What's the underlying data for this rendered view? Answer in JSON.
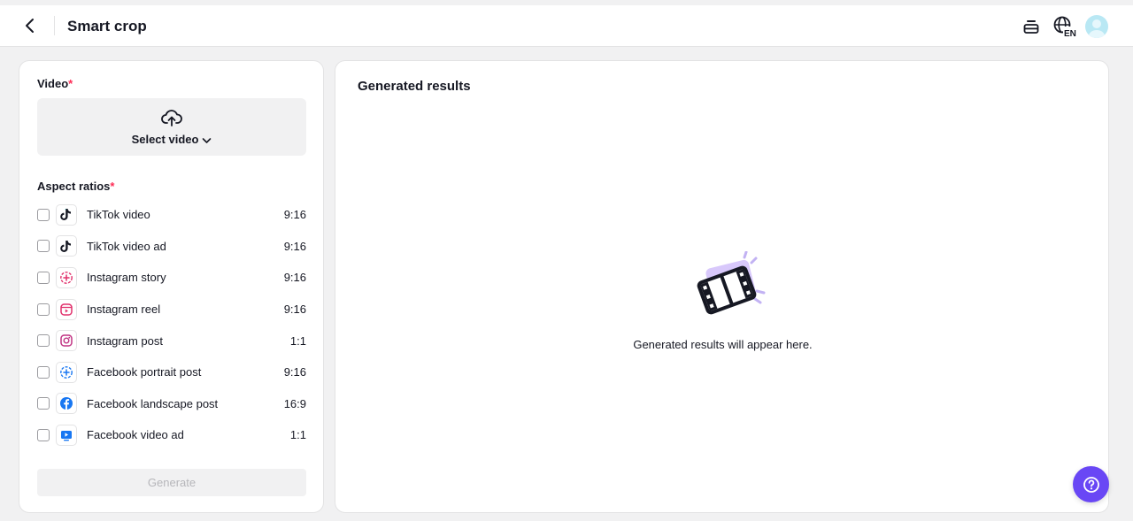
{
  "header": {
    "title": "Smart crop",
    "icons": [
      "back-arrow-icon",
      "queue-icon",
      "globe-language-icon",
      "avatar"
    ],
    "language_badge": "EN"
  },
  "left_panel": {
    "video_label": "Video",
    "required_mark": "*",
    "select_video_label": "Select video",
    "aspect_ratios_label": "Aspect ratios",
    "ratios": [
      {
        "name": "TikTok video",
        "ratio": "9:16",
        "icon": "tiktok-icon",
        "checked": false
      },
      {
        "name": "TikTok video ad",
        "ratio": "9:16",
        "icon": "tiktok-icon",
        "checked": false
      },
      {
        "name": "Instagram story",
        "ratio": "9:16",
        "icon": "instagram-story-icon",
        "checked": false
      },
      {
        "name": "Instagram reel",
        "ratio": "9:16",
        "icon": "instagram-reel-icon",
        "checked": false
      },
      {
        "name": "Instagram post",
        "ratio": "1:1",
        "icon": "instagram-icon",
        "checked": false
      },
      {
        "name": "Facebook portrait post",
        "ratio": "9:16",
        "icon": "facebook-story-icon",
        "checked": false
      },
      {
        "name": "Facebook landscape post",
        "ratio": "16:9",
        "icon": "facebook-icon",
        "checked": false
      },
      {
        "name": "Facebook video ad",
        "ratio": "1:1",
        "icon": "facebook-video-icon",
        "checked": false
      }
    ],
    "generate_label": "Generate"
  },
  "right_panel": {
    "title": "Generated results",
    "empty_message": "Generated results will appear here."
  },
  "colors": {
    "accent": "#6947f5",
    "required": "#fe2c55",
    "background": "#f1f1f2",
    "facebook": "#1877f2",
    "illustration": "#d8c8fb"
  }
}
